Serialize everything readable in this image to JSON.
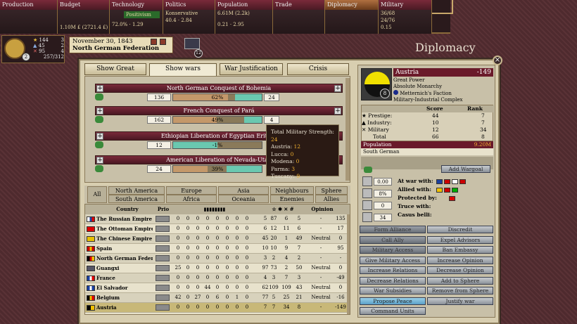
{
  "topbar": {
    "production": {
      "title": "Production"
    },
    "budget": {
      "title": "Budget",
      "line1": "1.10M £ (2721.4 £)"
    },
    "technology": {
      "title": "Technology",
      "line1": "Positivism",
      "line2": "72.0%",
      "line3": "1.29"
    },
    "politics": {
      "title": "Politics",
      "line1": "Konservative",
      "line2": "40.4",
      "line3": "2.84"
    },
    "population": {
      "title": "Population",
      "line1": "6.61M (2.2k)",
      "line2": "0.21",
      "line3": "2.95"
    },
    "trade": {
      "title": "Trade"
    },
    "diplomacy": {
      "title": "Diplomacy"
    },
    "military": {
      "title": "Military",
      "line1": "36/68",
      "line2": "24/76",
      "line3": "0.15"
    }
  },
  "player": {
    "prestige": "144",
    "p_rank": "3",
    "industry": "45",
    "i_rank": "2",
    "military": "95",
    "m_rank": "4",
    "score": "257/312",
    "rank": "2"
  },
  "date": {
    "text": "November 30, 1843",
    "nation": "North German Federation",
    "notif": "12"
  },
  "page_title": "Diplomacy",
  "tabs": [
    "Show Great Powers",
    "Show wars",
    "War Justification",
    "Crisis"
  ],
  "wars": [
    {
      "name": "North German Conquest of Bohemia",
      "left": "136",
      "pct": "62%",
      "right": "24",
      "fill": 62
    },
    {
      "name": "French Conquest of Pará",
      "left": "162",
      "pct": "49%",
      "right": "4",
      "fill": 49
    },
    {
      "name": "Ethiopian Liberation of Egyptian Eritrea",
      "left": "12",
      "pct": "-1%",
      "right": "",
      "fill": 50
    },
    {
      "name": "American Liberation of Nevada-Utah",
      "left": "24",
      "pct": "39%",
      "right": "",
      "fill": 39
    }
  ],
  "tooltip": {
    "title": "Total Military Strength:",
    "total": "24",
    "rows": [
      [
        "Austria:",
        "12"
      ],
      [
        "Lucca:",
        "0"
      ],
      [
        "Modena:",
        "0"
      ],
      [
        "Parma:",
        "3"
      ],
      [
        "Tuscany:",
        "9"
      ]
    ]
  },
  "filters": {
    "all": "All",
    "north_america": "North America",
    "south_america": "South America",
    "europe": "Europe",
    "africa": "Africa",
    "asia": "Asia",
    "oceania": "Oceania",
    "neighbours": "Neighbours",
    "enemies": "Enemies",
    "sphere": "Sphere",
    "allies": "Allies"
  },
  "table": {
    "headers": {
      "country": "Country",
      "prio": "Prio",
      "opinion": "Opinion"
    },
    "rows": [
      {
        "name": "The Russian Empire",
        "v": [
          "0",
          "0",
          "0",
          "0",
          "0",
          "0",
          "0",
          "0"
        ],
        "a": "5",
        "b": "87",
        "c": "6",
        "d": "5",
        "op": "-",
        "inf": "135",
        "flag": "#fff #1a3fa0 #d00"
      },
      {
        "name": "The Ottoman Empire",
        "v": [
          "0",
          "0",
          "0",
          "0",
          "0",
          "0",
          "0",
          "0"
        ],
        "a": "6",
        "b": "12",
        "c": "11",
        "d": "6",
        "op": "-",
        "inf": "17",
        "flag": "#d00"
      },
      {
        "name": "The Chinese Empire",
        "v": [
          "0",
          "0",
          "0",
          "0",
          "0",
          "0",
          "0",
          "0"
        ],
        "a": "45",
        "b": "20",
        "c": "1",
        "d": "49",
        "op": "Neutral",
        "inf": "0",
        "flag": "#e8c000"
      },
      {
        "name": "Spain",
        "v": [
          "0",
          "0",
          "0",
          "0",
          "0",
          "0",
          "0",
          "0"
        ],
        "a": "10",
        "b": "10",
        "c": "9",
        "d": "7",
        "op": "-",
        "inf": "95",
        "flag": "#c00 #f0c000 #c00"
      },
      {
        "name": "North German Feder ...",
        "v": [
          "0",
          "0",
          "0",
          "0",
          "0",
          "0",
          "0",
          "0"
        ],
        "a": "3",
        "b": "2",
        "c": "4",
        "d": "2",
        "op": "-",
        "inf": "-",
        "flag": "#000 #d00 #f0c000"
      },
      {
        "name": "Guangxi",
        "v": [
          "25",
          "0",
          "0",
          "0",
          "0",
          "0",
          "0",
          "0"
        ],
        "a": "97",
        "b": "73",
        "c": "2",
        "d": "50",
        "op": "Neutral",
        "inf": "0",
        "flag": "#556"
      },
      {
        "name": "France",
        "v": [
          "0",
          "0",
          "0",
          "0",
          "0",
          "0",
          "0",
          "0"
        ],
        "a": "4",
        "b": "3",
        "c": "7",
        "d": "3",
        "op": "-",
        "inf": "-49",
        "flag": "#1a3fa0 #fff #d00"
      },
      {
        "name": "El Salvador",
        "v": [
          "0",
          "0",
          "0",
          "44",
          "0",
          "0",
          "0",
          "0"
        ],
        "a": "62",
        "b": "109",
        "c": "109",
        "d": "43",
        "op": "Neutral",
        "inf": "0",
        "flag": "#1a3fa0 #fff #1a3fa0"
      },
      {
        "name": "Belgium",
        "v": [
          "42",
          "0",
          "27",
          "0",
          "6",
          "0",
          "1",
          "0"
        ],
        "a": "77",
        "b": "5",
        "c": "25",
        "d": "21",
        "op": "Neutral",
        "inf": "-16",
        "flag": "#000 #f0c000 #d00"
      },
      {
        "name": "Austria",
        "v": [
          "0",
          "0",
          "0",
          "0",
          "0",
          "0",
          "0",
          "0"
        ],
        "a": "7",
        "b": "7",
        "c": "34",
        "d": "8",
        "op": "-",
        "inf": "-149",
        "flag": "#000 #f0c000"
      }
    ]
  },
  "right": {
    "country": "Austria",
    "relation": "-149",
    "status": "Great Power",
    "government": "Absolute Monarchy",
    "faction": "Metternich's Faction",
    "party": "Military-Industrial Complex",
    "score_h": "Score",
    "rank_h": "Rank",
    "prestige": [
      "Prestige:",
      "44",
      "7"
    ],
    "industry": [
      "Industry:",
      "10",
      "7"
    ],
    "military": [
      "Military",
      "12",
      "34"
    ],
    "total": [
      "Total",
      "66",
      "8"
    ],
    "pop_label": "Population",
    "pop_value": "9.20M",
    "culture": "South German",
    "add_wargoal": "Add Wargoal",
    "war_with": "At war with:",
    "allied_with": "Allied with:",
    "protected_by": "Protected by:",
    "truce_with": "Truce with:",
    "casus_belli": "Casus belli:",
    "s1": "0.00",
    "s2": "8%",
    "s3": "0",
    "s4": "34",
    "rank_badge": "8",
    "buttons": [
      "Form Alliance",
      "Discredit",
      "Call Ally",
      "Expel Advisors",
      "Military Access",
      "Ban Embassy",
      "Give Military Access",
      "Increase Opinion",
      "Increase Relations",
      "Decrease Opinion",
      "Decrease Relations",
      "Add to Sphere",
      "War Subsidies",
      "Remove from Sphere",
      "Propose Peace",
      "Justify war",
      "Command Units"
    ]
  }
}
